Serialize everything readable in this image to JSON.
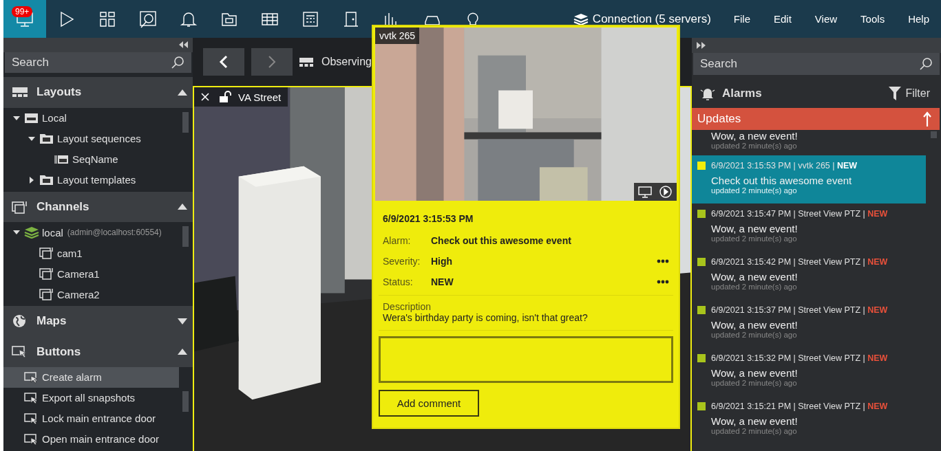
{
  "toolbar": [
    {
      "kind": "monitor",
      "selected": true,
      "badge": "99+"
    },
    {
      "kind": "play",
      "selected": false
    },
    {
      "kind": "layout",
      "selected": false
    },
    {
      "kind": "dial",
      "selected": false
    },
    {
      "kind": "bell",
      "selected": false
    },
    {
      "kind": "folder",
      "selected": false
    },
    {
      "kind": "table",
      "selected": false
    },
    {
      "kind": "keypad",
      "selected": false
    },
    {
      "kind": "door",
      "selected": false
    },
    {
      "kind": "chart",
      "selected": false
    },
    {
      "kind": "car",
      "selected": false
    },
    {
      "kind": "bulb",
      "selected": false
    }
  ],
  "connection": "Connection (5 servers)",
  "menu": [
    "File",
    "Edit",
    "View",
    "Tools",
    "Help"
  ],
  "sidebar": {
    "search": {
      "placeholder": "Search"
    },
    "sections": [
      {
        "title": "Layouts",
        "kind": "layouts",
        "expanded": true,
        "items": [
          {
            "label": "Local",
            "kind": "drive",
            "expanded": true,
            "selected": false,
            "children": [
              {
                "label": "Layout sequences",
                "kind": "sequences",
                "expanded": true,
                "selected": false,
                "children": [
                  {
                    "label": "SeqName",
                    "kind": "sequence",
                    "selected": false
                  }
                ]
              },
              {
                "label": "Layout templates",
                "kind": "templates",
                "expanded": false,
                "selected": false
              }
            ]
          }
        ]
      },
      {
        "title": "Channels",
        "kind": "channels",
        "expanded": true,
        "items": [
          {
            "label": "local",
            "note": "(admin@localhost:60554)",
            "kind": "server",
            "expanded": true,
            "selected": false,
            "children": [
              {
                "label": "cam1",
                "kind": "camera",
                "selected": false
              },
              {
                "label": "Camera1",
                "kind": "camera",
                "selected": false
              },
              {
                "label": "Camera2",
                "kind": "camera",
                "selected": false
              }
            ]
          }
        ]
      },
      {
        "title": "Maps",
        "kind": "maps",
        "expanded": false
      },
      {
        "title": "Buttons",
        "kind": "buttons",
        "expanded": true,
        "items": [
          {
            "label": "Create alarm",
            "kind": "button",
            "selected": true
          },
          {
            "label": "Export all snapshots",
            "kind": "button",
            "selected": false
          },
          {
            "label": "Lock main entrance door",
            "kind": "button",
            "selected": false
          },
          {
            "label": "Open main entrance door",
            "kind": "button",
            "selected": false
          }
        ]
      }
    ]
  },
  "viewer": {
    "title": "Observing",
    "tile": {
      "name": "VA Street",
      "locked": false
    }
  },
  "popup": {
    "camera": "vvtk 265",
    "time": "6/9/2021 3:15:53 PM",
    "fields": [
      {
        "label": "Alarm:",
        "value": "Check out this awesome event",
        "menu": false
      },
      {
        "label": "Severity:",
        "value": "High",
        "menu": true
      },
      {
        "label": "Status:",
        "value": "NEW",
        "menu": true
      }
    ],
    "description_label": "Description",
    "description": "Wera's birthday party is coming, isn't that great?",
    "button": "Add comment"
  },
  "alarms_panel": {
    "search": {
      "placeholder": "Search"
    },
    "title": "Alarms",
    "filter": "Filter",
    "updates": "Updates",
    "alarms": [
      {
        "title": "Wow, a new event!",
        "updated": "updated 2 minute(s) ago",
        "selected": false
      },
      {
        "color": "#f2ee0a",
        "meta": "6/9/2021 3:15:53 PM | vvtk 265 | **NEW**",
        "title": "Check out this awesome event",
        "updated": "updated 2 minute(s) ago",
        "selected": true
      },
      {
        "color": "#a8c41c",
        "meta": "6/9/2021 3:15:47 PM | Street View PTZ | **NEW**",
        "title": "Wow, a new event!",
        "updated": "updated 2 minute(s) ago",
        "selected": false
      },
      {
        "color": "#a8c41c",
        "meta": "6/9/2021 3:15:42 PM | Street View PTZ | **NEW**",
        "title": "Wow, a new event!",
        "updated": "updated 2 minute(s) ago",
        "selected": false
      },
      {
        "color": "#a8c41c",
        "meta": "6/9/2021 3:15:37 PM | Street View PTZ | **NEW**",
        "title": "Wow, a new event!",
        "updated": "updated 2 minute(s) ago",
        "selected": false
      },
      {
        "color": "#a8c41c",
        "meta": "6/9/2021 3:15:32 PM | Street View PTZ | **NEW**",
        "title": "Wow, a new event!",
        "updated": "updated 2 minute(s) ago",
        "selected": false
      },
      {
        "color": "#a8c41c",
        "meta": "6/9/2021 3:15:21 PM | Street View PTZ | **NEW**",
        "title": "Wow, a new event!",
        "updated": "updated 2 minute(s) ago",
        "selected": false
      }
    ]
  }
}
